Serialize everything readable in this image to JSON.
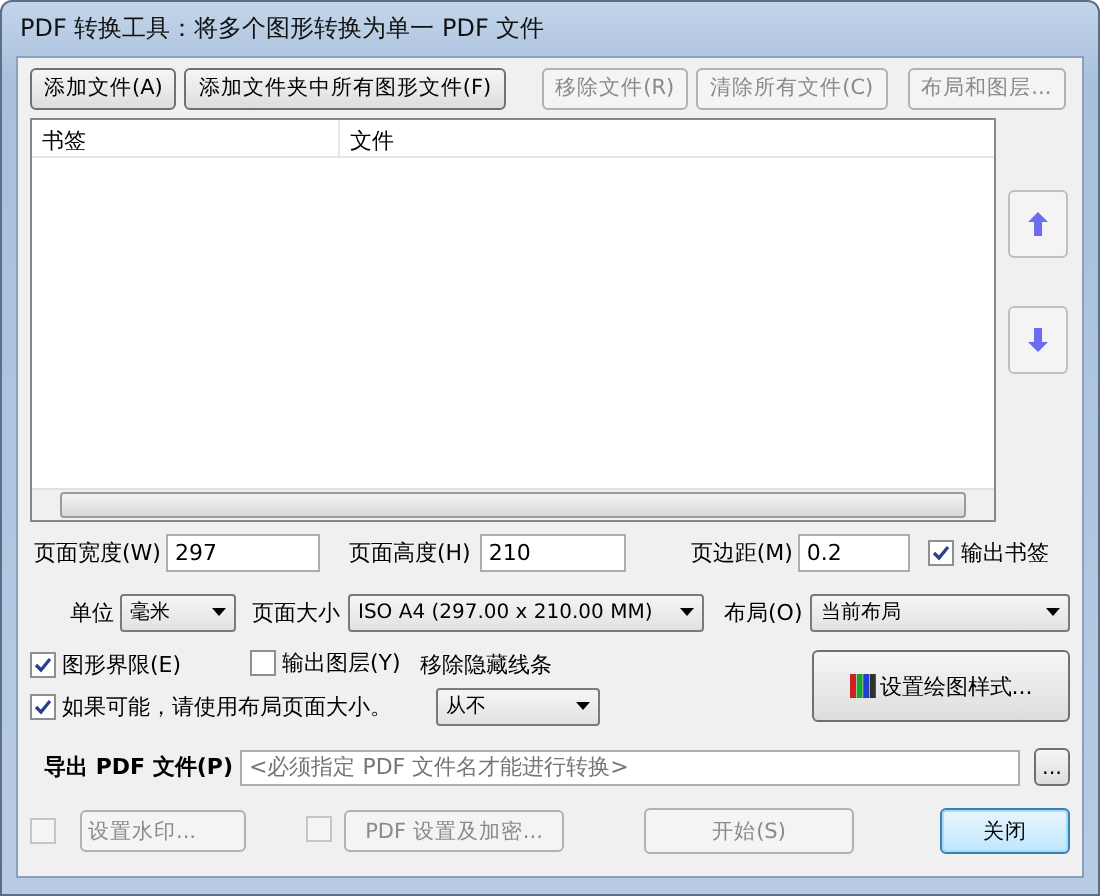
{
  "window": {
    "title": "PDF 转换工具：将多个图形转换为单一 PDF 文件"
  },
  "toolbar_buttons": [
    {
      "label": "添加文件(A)",
      "disabled": false
    },
    {
      "label": "添加文件夹中所有图形文件(F)",
      "disabled": false
    },
    {
      "label": "移除文件(R)",
      "disabled": true
    },
    {
      "label": "清除所有文件(C)",
      "disabled": true
    },
    {
      "label": "布局和图层...",
      "disabled": true
    }
  ],
  "list": {
    "columns": [
      "书签",
      "文件"
    ]
  },
  "page_fields": [
    {
      "label": "页面宽度(W)",
      "value": "297"
    },
    {
      "label": "页面高度(H)",
      "value": "210"
    },
    {
      "label": "页边距(M)",
      "value": "0.2"
    }
  ],
  "output_bookmarks": {
    "label": "输出书签",
    "checked": true
  },
  "unit": {
    "label": "单位",
    "value": "毫米"
  },
  "page_size": {
    "label": "页面大小",
    "value": "ISO A4 (297.00 x 210.00 MM)"
  },
  "layout": {
    "label": "布局(O)",
    "value": "当前布局"
  },
  "options": [
    {
      "label": "图形界限(E)",
      "checked": true
    },
    {
      "label": "输出图层(Y)",
      "checked": false
    },
    {
      "label": "如果可能，请使用布局页面大小。",
      "checked": true
    }
  ],
  "hidden_lines": {
    "label": "移除隐藏线条",
    "value": "从不"
  },
  "plot_style_button": {
    "label": "设置绘图样式..."
  },
  "export": {
    "label": "导出 PDF 文件(P)",
    "placeholder": "<必须指定 PDF 文件名才能进行转换>",
    "browse": "..."
  },
  "footer_options": [
    {
      "label": "设置水印...",
      "checked": false,
      "disabled": true
    },
    {
      "label": "PDF 设置及加密...",
      "checked": false,
      "disabled": true
    }
  ],
  "start_button": {
    "label": "开始(S)",
    "disabled": true
  },
  "close_button": {
    "label": "关闭",
    "focused": true
  }
}
